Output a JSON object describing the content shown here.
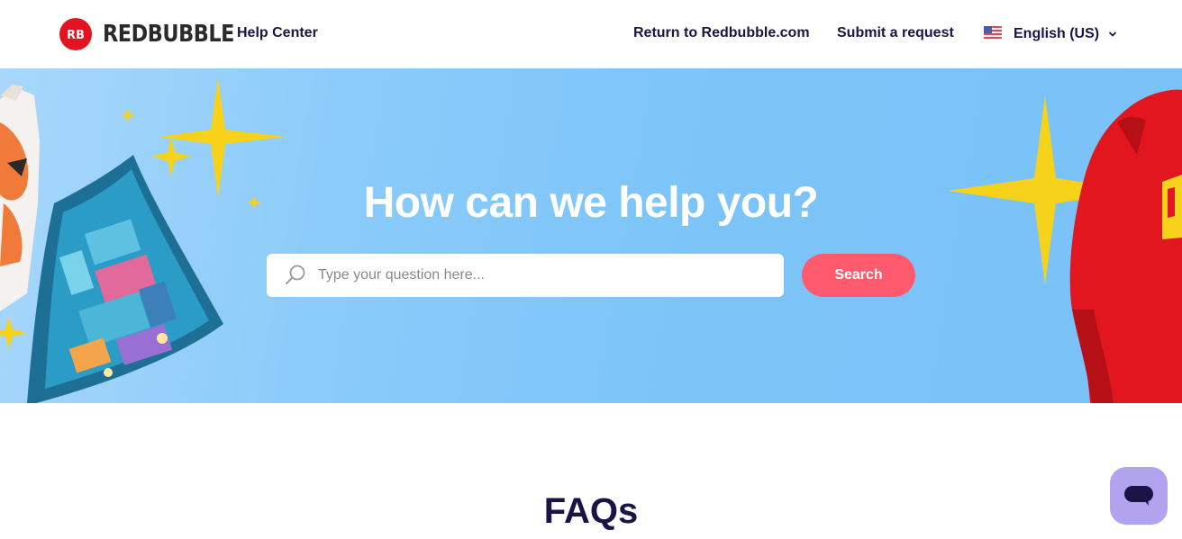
{
  "header": {
    "brand_name": "REDBUBBLE",
    "help_center_label": "Help Center",
    "nav": {
      "return_label": "Return to Redbubble.com",
      "submit_label": "Submit a request"
    },
    "language": {
      "selected": "English (US)",
      "flag_icon": "us-flag-icon"
    }
  },
  "hero": {
    "title": "How can we help you?",
    "search": {
      "placeholder": "Type your question here...",
      "value": "",
      "button_label": "Search"
    }
  },
  "faq": {
    "title": "FAQs"
  },
  "chat": {
    "icon": "chat-bubble-icon"
  },
  "colors": {
    "brand_red": "#e41321",
    "hero_blue": "#7cc4f8",
    "search_button": "#ff5a6e",
    "text_navy": "#1a1446",
    "chat_purple": "#b2a3ef",
    "sparkle_yellow": "#f7d21a"
  }
}
